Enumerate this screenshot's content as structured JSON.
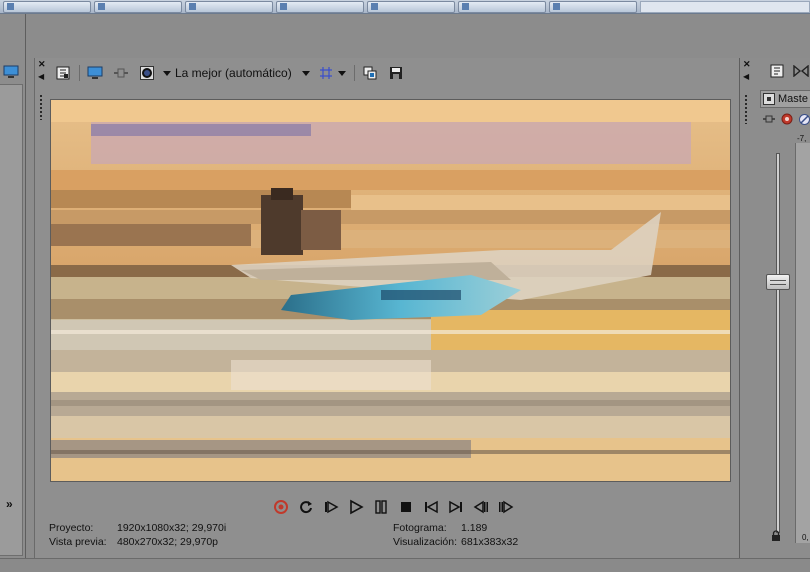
{
  "preview": {
    "quality_label": "La mejor (automático)",
    "status": {
      "project_label": "Proyecto:",
      "project_value": "1920x1080x32; 29,970i",
      "preview_label": "Vista previa:",
      "preview_value": "480x270x32; 29,970p",
      "frame_label": "Fotograma:",
      "frame_value": "1.189",
      "display_label": "Visualización:",
      "display_value": "681x383x32"
    }
  },
  "mixer": {
    "master_label": "Maste",
    "meter_top": "-7,",
    "meter_bottom": "0,"
  },
  "left_panel": {
    "chevron_text": "»"
  },
  "colors": {
    "record_red": "#c0392b",
    "panel_gray": "#8f8f8f",
    "monitor_blue": "#1f6fb5"
  }
}
